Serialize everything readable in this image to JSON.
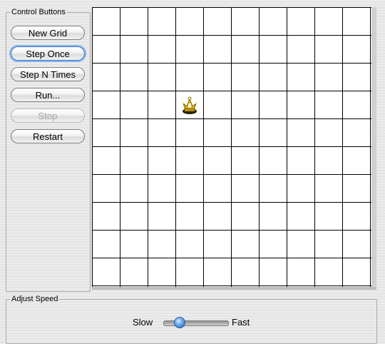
{
  "control_group": {
    "title": "Control Buttons",
    "buttons": [
      {
        "label": "New Grid",
        "state": "normal"
      },
      {
        "label": "Step Once",
        "state": "focused"
      },
      {
        "label": "Step N Times",
        "state": "normal"
      },
      {
        "label": "Run...",
        "state": "normal"
      },
      {
        "label": "Stop",
        "state": "disabled"
      },
      {
        "label": "Restart",
        "state": "normal"
      }
    ]
  },
  "grid": {
    "rows": 10,
    "cols": 10,
    "critters": [
      {
        "name": "crown-critter-icon",
        "row": 3,
        "col": 3
      }
    ]
  },
  "speed_group": {
    "title": "Adjust Speed",
    "slow_label": "Slow",
    "fast_label": "Fast",
    "value": 0.2
  }
}
